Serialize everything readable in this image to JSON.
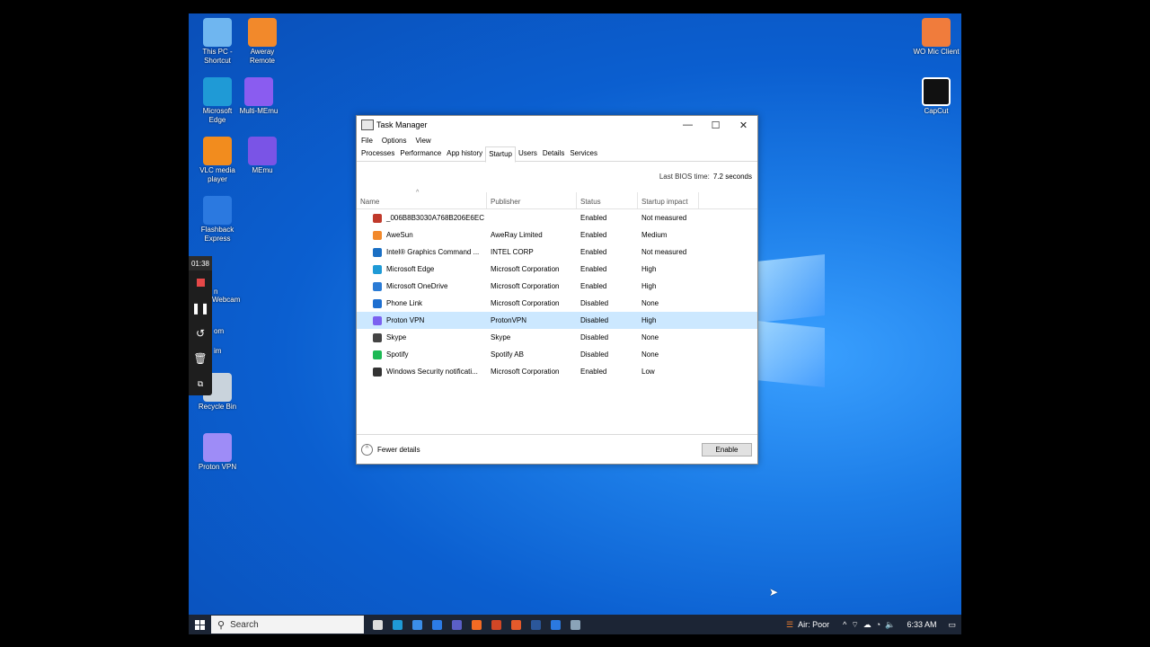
{
  "desktop": {
    "icons_left": [
      {
        "label": "This PC - Shortcut",
        "color": "#6fb6f0"
      },
      {
        "label": "Aweray Remote",
        "color": "#f2892b"
      },
      {
        "label": "Microsoft Edge",
        "color": "#1f9ad6"
      },
      {
        "label": "Multi-MEmu",
        "color": "#8a5cf0"
      },
      {
        "label": "VLC media player",
        "color": "#f28c1e"
      },
      {
        "label": "MEmu",
        "color": "#7a54e6"
      },
      {
        "label": "Flashback Express",
        "color": "#2b79e0"
      },
      {
        "label": "Recycle Bin",
        "color": "#c9d3dc"
      },
      {
        "label": "Proton VPN",
        "color": "#9e8cf7"
      }
    ],
    "partial_labels": [
      "n",
      "Webcam",
      "om",
      "im"
    ],
    "icons_right": [
      {
        "label": "WO Mic Client",
        "color": "#f07c3c"
      },
      {
        "label": "CapCut",
        "color": "#111111"
      }
    ]
  },
  "recorder": {
    "time": "01:38"
  },
  "task_manager": {
    "title": "Task Manager",
    "menu": [
      "File",
      "Options",
      "View"
    ],
    "tabs": [
      "Processes",
      "Performance",
      "App history",
      "Startup",
      "Users",
      "Details",
      "Services"
    ],
    "active_tab": "Startup",
    "bios_label": "Last BIOS time:",
    "bios_value": "7.2 seconds",
    "columns": [
      "Name",
      "Publisher",
      "Status",
      "Startup impact"
    ],
    "rows": [
      {
        "name": "_006B8B3030A768B206E6EC",
        "publisher": "",
        "status": "Enabled",
        "impact": "Not measured",
        "icon_color": "#c0392b"
      },
      {
        "name": "AweSun",
        "publisher": "AweRay Limited",
        "status": "Enabled",
        "impact": "Medium",
        "icon_color": "#f2892b"
      },
      {
        "name": "Intel® Graphics Command ...",
        "publisher": "INTEL CORP",
        "status": "Enabled",
        "impact": "Not measured",
        "icon_color": "#1a6fc4"
      },
      {
        "name": "Microsoft Edge",
        "publisher": "Microsoft Corporation",
        "status": "Enabled",
        "impact": "High",
        "icon_color": "#1f9ad6"
      },
      {
        "name": "Microsoft OneDrive",
        "publisher": "Microsoft Corporation",
        "status": "Enabled",
        "impact": "High",
        "icon_color": "#2a7bd5"
      },
      {
        "name": "Phone Link",
        "publisher": "Microsoft Corporation",
        "status": "Disabled",
        "impact": "None",
        "icon_color": "#1e6fd0"
      },
      {
        "name": "Proton VPN",
        "publisher": "ProtonVPN",
        "status": "Disabled",
        "impact": "High",
        "icon_color": "#7b61f0"
      },
      {
        "name": "Skype",
        "publisher": "Skype",
        "status": "Disabled",
        "impact": "None",
        "icon_color": "#444444"
      },
      {
        "name": "Spotify",
        "publisher": "Spotify AB",
        "status": "Disabled",
        "impact": "None",
        "icon_color": "#1db954"
      },
      {
        "name": "Windows Security notificati...",
        "publisher": "Microsoft Corporation",
        "status": "Enabled",
        "impact": "Low",
        "icon_color": "#333333"
      }
    ],
    "selected_row": 6,
    "fewer_details": "Fewer details",
    "enable_button": "Enable"
  },
  "taskbar": {
    "search_placeholder": "Search",
    "apps": [
      {
        "name": "task-view",
        "color": "#dddddd"
      },
      {
        "name": "edge",
        "color": "#1f9ad6"
      },
      {
        "name": "store",
        "color": "#3b8ee8"
      },
      {
        "name": "mail",
        "color": "#2c7be5"
      },
      {
        "name": "teams",
        "color": "#5b5fc7"
      },
      {
        "name": "firefox",
        "color": "#f46b24"
      },
      {
        "name": "powerpoint",
        "color": "#d24726"
      },
      {
        "name": "aweray",
        "color": "#e55a2b"
      },
      {
        "name": "word",
        "color": "#2b579a"
      },
      {
        "name": "flashback",
        "color": "#2b79e0"
      },
      {
        "name": "task-manager",
        "color": "#8aa3b8"
      }
    ],
    "weather": "Air: Poor",
    "clock": "6:33 AM"
  }
}
